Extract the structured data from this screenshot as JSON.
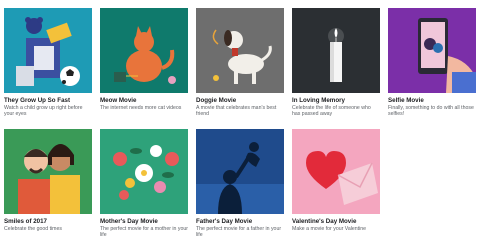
{
  "movies": [
    {
      "title": "They Grow Up So Fast",
      "desc": "Watch a child grow up right before your eyes",
      "bg": "#1e9bb5"
    },
    {
      "title": "Meow Movie",
      "desc": "The internet needs more cat videos",
      "bg": "#0f7a6c"
    },
    {
      "title": "Doggie Movie",
      "desc": "A movie that celebrates man's best friend",
      "bg": "#6e6e6e"
    },
    {
      "title": "In Loving Memory",
      "desc": "Celebrate the life of someone who has passed away",
      "bg": "#2b2f33"
    },
    {
      "title": "Selfie Movie",
      "desc": "Finally, something to do with all those selfies!",
      "bg": "#7b2fa8"
    },
    {
      "title": "Smiles of 2017",
      "desc": "Celebrate the good times",
      "bg": "#3a9a57"
    },
    {
      "title": "Mother's Day Movie",
      "desc": "The perfect movie for a mother in your life",
      "bg": "#2ea27a"
    },
    {
      "title": "Father's Day Movie",
      "desc": "The perfect movie for a father in your life",
      "bg": "#1f4b8c"
    },
    {
      "title": "Valentine's Day Movie",
      "desc": "Make a movie for your Valentine",
      "bg": "#f4a6bf"
    }
  ]
}
